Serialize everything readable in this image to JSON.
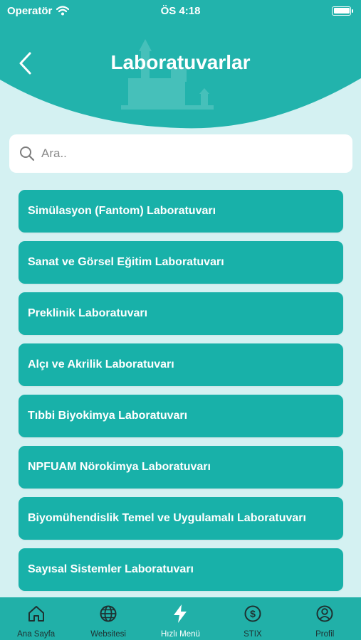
{
  "status_bar": {
    "carrier": "Operatör",
    "time": "ÖS 4:18"
  },
  "header": {
    "title": "Laboratuvarlar",
    "back_icon": "chevron-left-icon"
  },
  "search": {
    "placeholder": "Ara..",
    "value": ""
  },
  "labs": [
    "Simülasyon (Fantom) Laboratuvarı",
    "Sanat ve Görsel Eğitim Laboratuvarı",
    "Preklinik Laboratuvarı",
    "Alçı ve Akrilik Laboratuvarı",
    "Tıbbi Biyokimya Laboratuvarı",
    "NPFUAM Nörokimya Laboratuvarı",
    "Biyomühendislik Temel ve Uygulamalı Laboratuvarı",
    "Sayısal Sistemler Laboratuvarı"
  ],
  "tabbar": {
    "items": [
      {
        "label": "Ana Sayfa",
        "icon": "home-icon"
      },
      {
        "label": "Websitesi",
        "icon": "globe-icon"
      },
      {
        "label": "Hızlı Menü",
        "icon": "lightning-icon"
      },
      {
        "label": "STIX",
        "icon": "dollar-icon"
      },
      {
        "label": "Profil",
        "icon": "profile-icon"
      }
    ]
  },
  "colors": {
    "accent": "#18b1a9",
    "header": "#22b3ac",
    "background": "#d4f1f2",
    "tabbar": "#21b0a8"
  }
}
